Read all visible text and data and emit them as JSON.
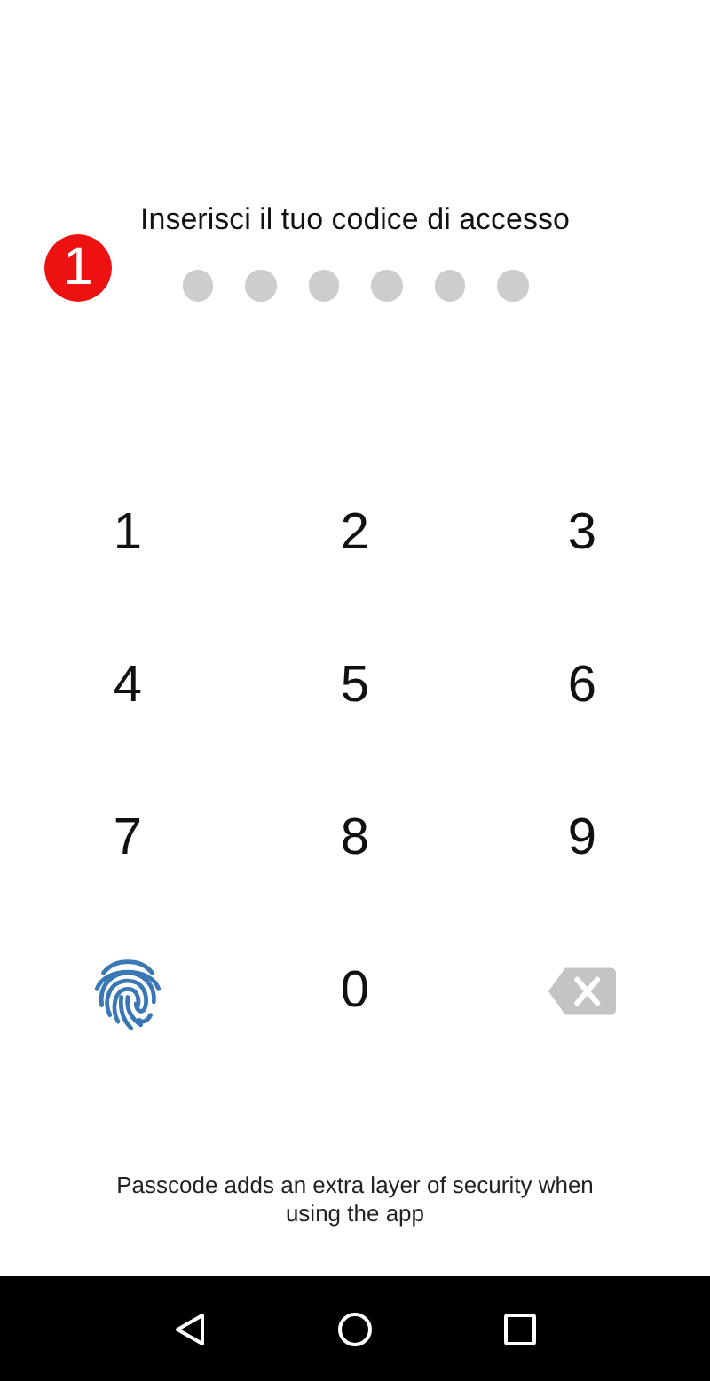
{
  "badge": "1",
  "prompt": "Inserisci il tuo codice di accesso",
  "pin_dots": [
    {
      "filled": false
    },
    {
      "filled": false
    },
    {
      "filled": false
    },
    {
      "filled": false
    },
    {
      "filled": false
    },
    {
      "filled": false
    }
  ],
  "keypad": [
    {
      "kind": "digit",
      "label": "1"
    },
    {
      "kind": "digit",
      "label": "2"
    },
    {
      "kind": "digit",
      "label": "3"
    },
    {
      "kind": "digit",
      "label": "4"
    },
    {
      "kind": "digit",
      "label": "5"
    },
    {
      "kind": "digit",
      "label": "6"
    },
    {
      "kind": "digit",
      "label": "7"
    },
    {
      "kind": "digit",
      "label": "8"
    },
    {
      "kind": "digit",
      "label": "9"
    },
    {
      "kind": "fingerprint"
    },
    {
      "kind": "digit",
      "label": "0"
    },
    {
      "kind": "backspace"
    }
  ],
  "footer": "Passcode adds an extra layer of security when using the app",
  "nav_bar": [
    {
      "kind": "back"
    },
    {
      "kind": "home"
    },
    {
      "kind": "recents"
    }
  ]
}
